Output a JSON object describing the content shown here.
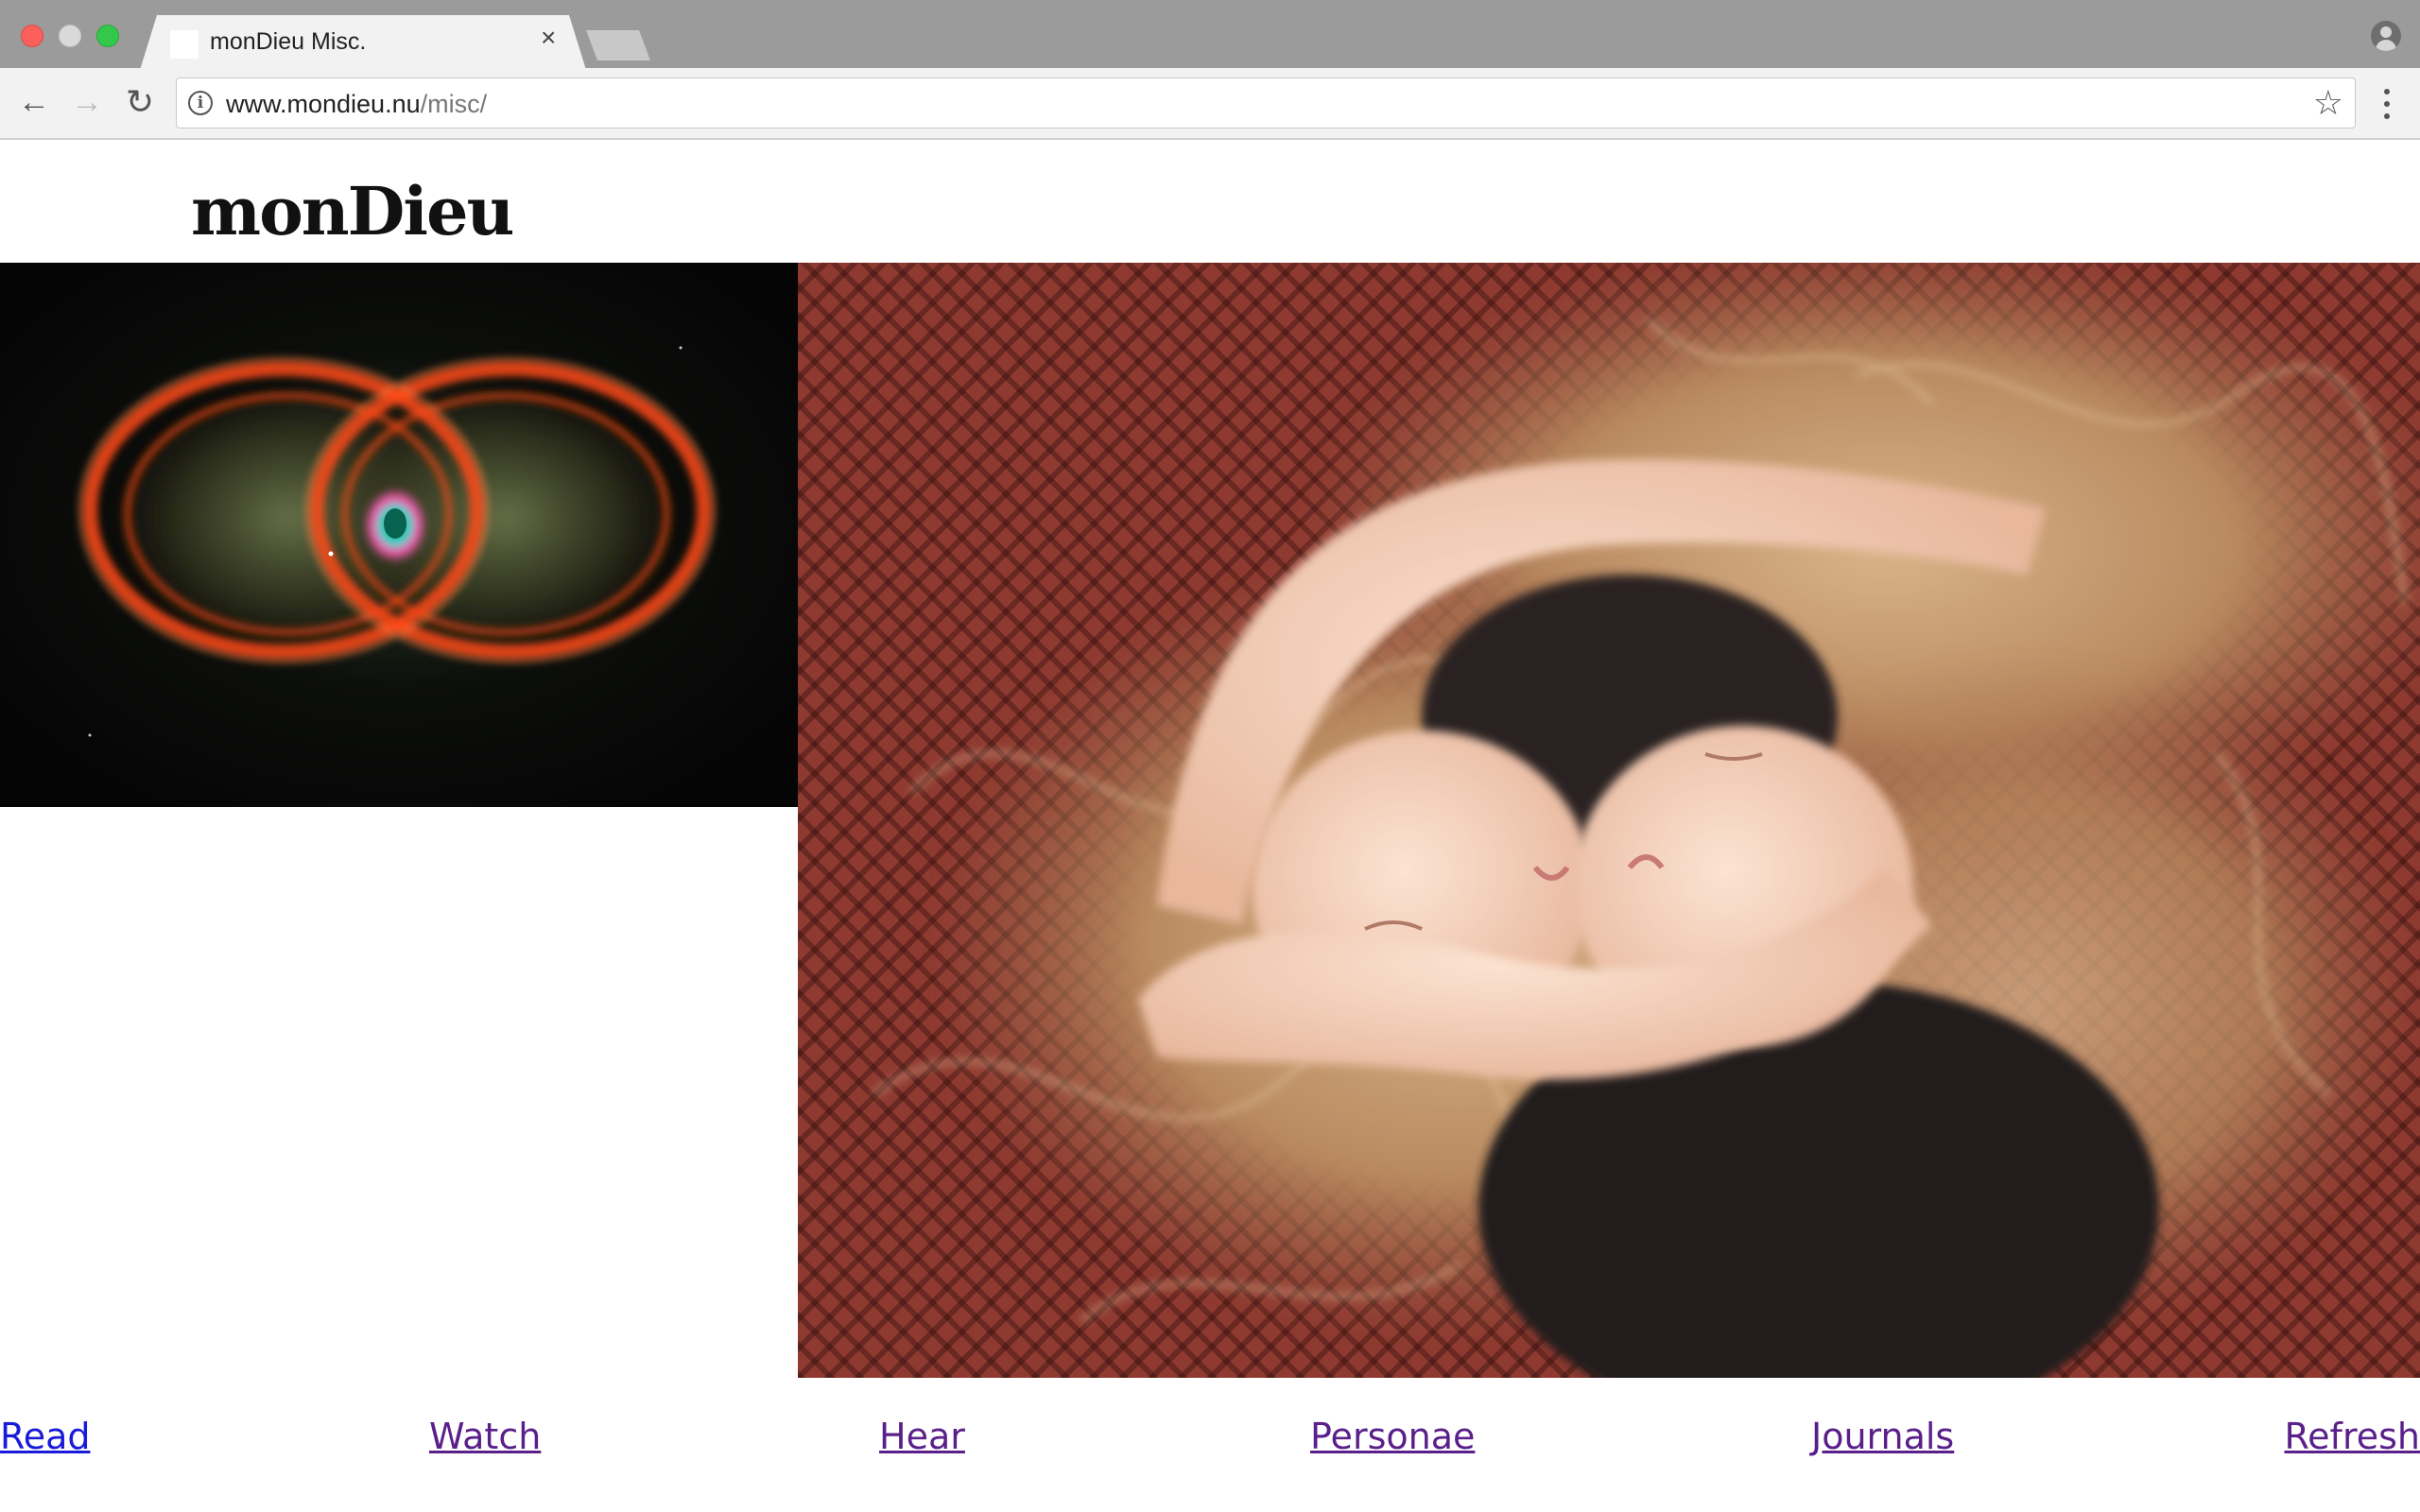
{
  "browser": {
    "tab": {
      "title": "monDieu Misc.",
      "close_glyph": "×"
    },
    "url": {
      "host": "www.mondieu.nu",
      "path": "/misc/"
    },
    "icons": {
      "back": "back-arrow-icon",
      "forward": "forward-arrow-icon",
      "reload": "reload-icon",
      "info": "info-icon",
      "bookmark": "star-icon",
      "menu": "kebab-menu-icon",
      "profile": "profile-icon"
    },
    "glyphs": {
      "back": "←",
      "forward": "→",
      "reload": "↻",
      "info": "i",
      "star": "☆"
    }
  },
  "page": {
    "logo": "monDieu",
    "images": [
      {
        "name": "nebula-image",
        "description_colors": [
          "#ff5a1e",
          "#2fe0c8",
          "#070708"
        ]
      },
      {
        "name": "twins-photo",
        "description_colors": [
          "#8e3a30",
          "#c9a27a",
          "#f0c9b0"
        ]
      }
    ],
    "nav": [
      {
        "label": "Read",
        "visited": false
      },
      {
        "label": "Watch",
        "visited": true
      },
      {
        "label": "Hear",
        "visited": true
      },
      {
        "label": "Personae",
        "visited": true
      },
      {
        "label": "Journals",
        "visited": true
      },
      {
        "label": "Refresh",
        "visited": true
      }
    ]
  }
}
